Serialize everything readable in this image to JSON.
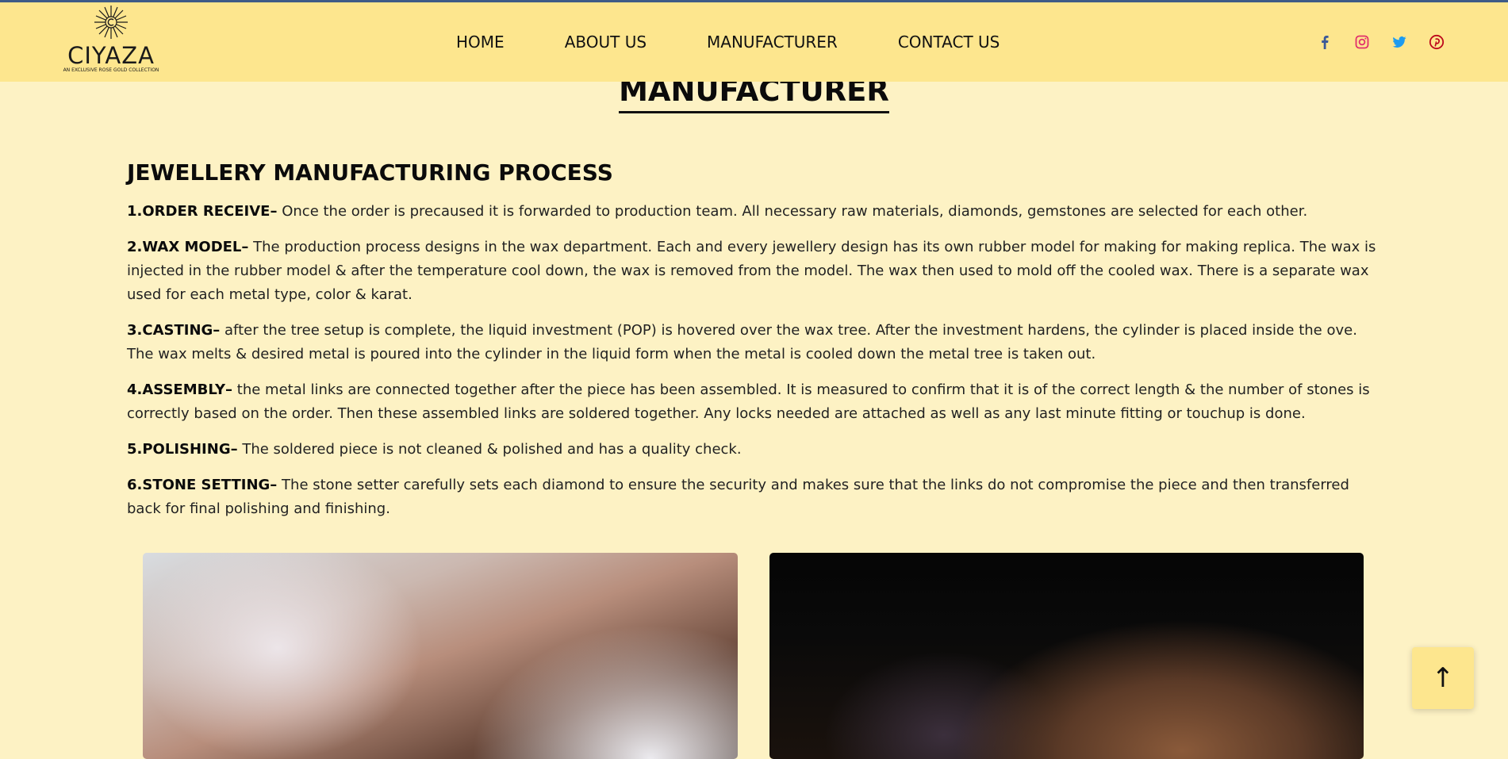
{
  "brand": {
    "name": "CIYAZA",
    "tagline": "AN EXCLUSIVE ROSE GOLD COLLECTION"
  },
  "nav": {
    "items": [
      {
        "label": "HOME"
      },
      {
        "label": "ABOUT US"
      },
      {
        "label": "MANUFACTURER"
      },
      {
        "label": "CONTACT US"
      }
    ]
  },
  "social": [
    {
      "icon": "facebook-icon",
      "color": "#3b5998"
    },
    {
      "icon": "instagram-icon",
      "color": "#e1306c"
    },
    {
      "icon": "twitter-icon",
      "color": "#1da1f2"
    },
    {
      "icon": "pinterest-icon",
      "color": "#bd081c"
    }
  ],
  "page": {
    "title": "MANUFACTURER"
  },
  "process": {
    "heading": "JEWELLERY MANUFACTURING PROCESS",
    "steps": [
      {
        "label": "1.ORDER RECEIVE–",
        "text": "Once the order is precaused it is forwarded to production team. All necessary raw materials, diamonds, gemstones are selected for each other."
      },
      {
        "label": "2.WAX MODEL–",
        "text": "The production process designs in the wax department. Each and every jewellery design has its own rubber model for making for making replica. The wax is injected in the rubber model & after the temperature cool down, the wax is removed from the model. The wax then used to mold off the cooled wax. There is a separate wax used for each metal type, color & karat."
      },
      {
        "label": "3.CASTING–",
        "text": "after the tree setup is complete, the liquid investment (POP) is hovered over the wax tree. After the investment hardens, the cylinder is placed inside the ove. The wax melts & desired metal is poured into the cylinder in the liquid form when the metal is cooled down the metal tree is taken out."
      },
      {
        "label": "4.ASSEMBLY–",
        "text": "the metal links are connected together after the piece has been assembled. It is measured to confirm that it is of the correct length & the number of stones is correctly based on the order. Then these assembled links are soldered together. Any locks needed are attached as well as any last minute fitting or touchup is done."
      },
      {
        "label": "5.POLISHING–",
        "text": "The soldered piece is not cleaned & polished and has a quality check."
      },
      {
        "label": "6.STONE SETTING–",
        "text": "The stone setter carefully sets each diamond to ensure the security and makes sure that the links do not compromise the piece and then transferred back for final polishing and finishing."
      }
    ]
  },
  "scroll_top": {
    "label": "↑"
  },
  "colors": {
    "header_bg": "#fde68e",
    "page_bg": "#fdf2c4",
    "top_line": "#3f5b86"
  }
}
